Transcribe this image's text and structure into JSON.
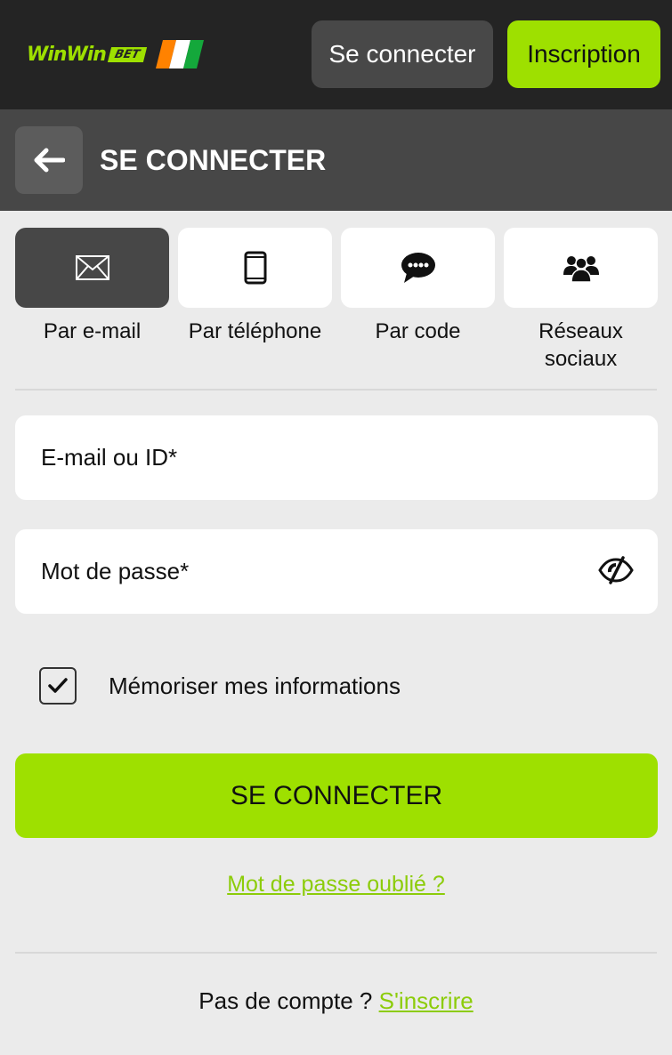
{
  "header": {
    "logo_text": "WinWin",
    "logo_badge": "BET",
    "login_label": "Se connecter",
    "signup_label": "Inscription"
  },
  "subheader": {
    "title": "SE CONNECTER"
  },
  "tabs": [
    {
      "label": "Par e-mail",
      "icon": "envelope-icon",
      "active": true
    },
    {
      "label": "Par téléphone",
      "icon": "phone-icon",
      "active": false
    },
    {
      "label": "Par code",
      "icon": "chat-bubble-icon",
      "active": false
    },
    {
      "label": "Réseaux sociaux",
      "icon": "users-icon",
      "active": false
    }
  ],
  "form": {
    "email_placeholder": "E-mail ou ID*",
    "password_placeholder": "Mot de passe*",
    "remember_label": "Mémoriser mes informations",
    "remember_checked": true,
    "submit_label": "SE CONNECTER",
    "forgot_label": "Mot de passe oublié ?"
  },
  "footer": {
    "no_account_text": "Pas de compte ? ",
    "signup_link": "S'inscrire"
  },
  "colors": {
    "accent": "#9ee000",
    "header_bg": "#242424",
    "subheader_bg": "#474747",
    "page_bg": "#ebebeb",
    "link": "#8ccc0a"
  }
}
